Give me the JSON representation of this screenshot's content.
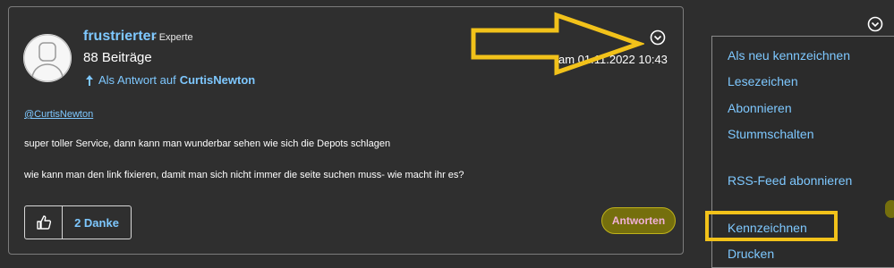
{
  "post": {
    "author": "frustrierter",
    "rank": "- Experte",
    "post_count": "88 Beiträge",
    "reply_prefix": "Als Antwort auf",
    "reply_target": "CurtisNewton",
    "date": "am 01.11.2022 10:43",
    "mention": "@CurtisNewton",
    "body": [
      "super toller Service, dann kann man wunderbar sehen wie sich die Depots schlagen",
      "wie kann man den link fixieren, damit man sich nicht immer die seite suchen muss- wie macht ihr es?"
    ],
    "kudos_label": "2 Danke",
    "reply_button": "Antworten"
  },
  "menu": {
    "items": [
      "Als neu kennzeichnen",
      "Lesezeichen",
      "Abonnieren",
      "Stummschalten",
      "RSS-Feed abonnieren",
      "Kennzeichnen",
      "Drucken"
    ]
  },
  "colors": {
    "link": "#7ec8ff",
    "annotation": "#f2c21a",
    "reply_button_bg": "#756f0d",
    "background": "#2e2e2e"
  },
  "icons": [
    "user-avatar-icon",
    "reply-arrow-icon",
    "chevron-circle-down-icon",
    "thumbs-up-icon",
    "annotation-arrow"
  ]
}
